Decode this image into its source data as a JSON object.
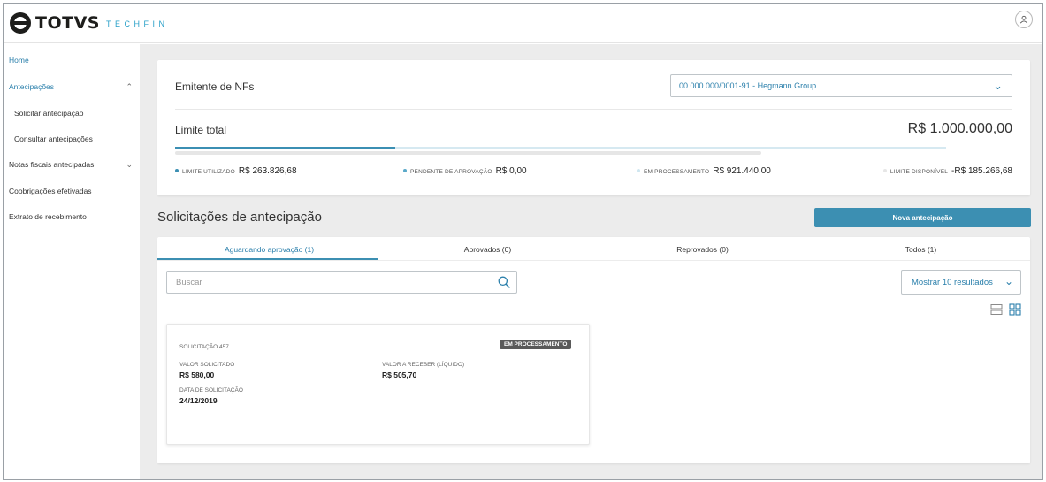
{
  "header": {
    "brand": "TOTVS",
    "brand_sub": "TECHFIN",
    "user_icon": "user-icon"
  },
  "sidebar": {
    "items": [
      {
        "label": "Home"
      },
      {
        "label": "Antecipações",
        "icon": "chevron-up-icon"
      },
      {
        "label": "Solicitar antecipação"
      },
      {
        "label": "Consultar antecipações"
      },
      {
        "label": "Notas fiscais antecipadas",
        "icon": "chevron-down-icon"
      },
      {
        "label": "Coobrigações efetivadas"
      },
      {
        "label": "Extrato de recebimento"
      }
    ]
  },
  "emitente": {
    "label": "Emitente de NFs",
    "selected": "00.000.000/0001-91 - Hegmann Group"
  },
  "limite": {
    "label": "Limite total",
    "value": "R$ 1.000.000,00",
    "utilizado_fraction": 0.286,
    "processamento_fraction": 0.76,
    "legend": [
      {
        "label": "Limite utilizado",
        "value": "R$ 263.826,68",
        "color": "#3b8fb3"
      },
      {
        "label": "Pendente de aprovação",
        "value": "R$ 0,00",
        "color": "#5aa9c9"
      },
      {
        "label": "Em processamento",
        "value": "R$ 921.440,00",
        "color": "#cfe6f0"
      },
      {
        "label": "Limite disponível",
        "value": "-R$ 185.266,68",
        "color": "#e6e6e6"
      }
    ]
  },
  "section": {
    "title": "Solicitações de antecipação",
    "new_button": "Nova antecipação"
  },
  "tabs": [
    {
      "label": "Aguardando aprovação (1)"
    },
    {
      "label": "Aprovados (0)"
    },
    {
      "label": "Reprovados (0)"
    },
    {
      "label": "Todos (1)"
    }
  ],
  "search": {
    "placeholder": "Buscar"
  },
  "results": {
    "label": "Mostrar 10 resultados"
  },
  "request": {
    "title": "Solicitação 457",
    "status": "Em processamento",
    "valor_solicitado_label": "Valor solicitado",
    "valor_solicitado": "R$ 580,00",
    "valor_receber_label": "Valor a receber (líquido)",
    "valor_receber": "R$ 505,70",
    "data_label": "Data de solicitação",
    "data": "24/12/2019"
  },
  "colors": {
    "accent": "#3c8fb2",
    "link": "#2a7fab"
  }
}
